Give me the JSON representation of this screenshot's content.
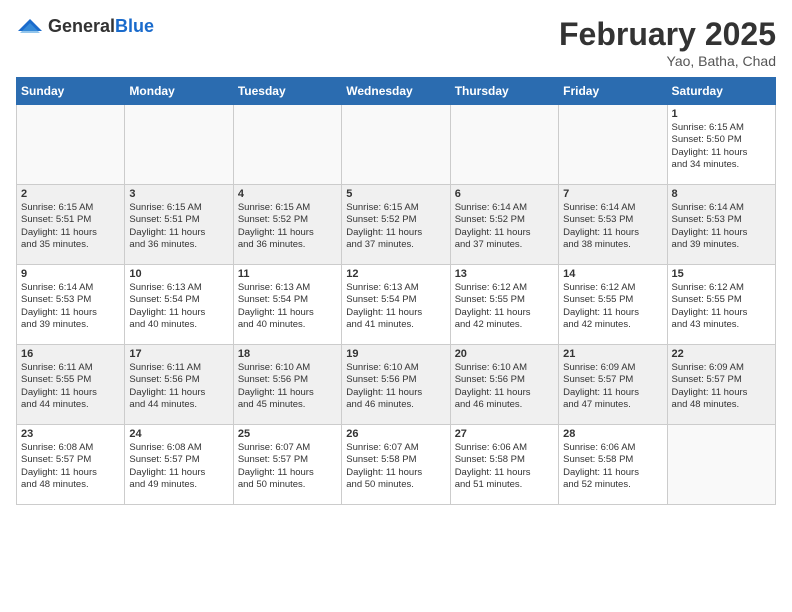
{
  "header": {
    "logo": {
      "general": "General",
      "blue": "Blue"
    },
    "title": "February 2025",
    "location": "Yao, Batha, Chad"
  },
  "calendar": {
    "days_of_week": [
      "Sunday",
      "Monday",
      "Tuesday",
      "Wednesday",
      "Thursday",
      "Friday",
      "Saturday"
    ],
    "weeks": [
      {
        "shaded": false,
        "days": [
          {
            "number": "",
            "info": ""
          },
          {
            "number": "",
            "info": ""
          },
          {
            "number": "",
            "info": ""
          },
          {
            "number": "",
            "info": ""
          },
          {
            "number": "",
            "info": ""
          },
          {
            "number": "",
            "info": ""
          },
          {
            "number": "1",
            "info": "Sunrise: 6:15 AM\nSunset: 5:50 PM\nDaylight: 11 hours\nand 34 minutes."
          }
        ]
      },
      {
        "shaded": true,
        "days": [
          {
            "number": "2",
            "info": "Sunrise: 6:15 AM\nSunset: 5:51 PM\nDaylight: 11 hours\nand 35 minutes."
          },
          {
            "number": "3",
            "info": "Sunrise: 6:15 AM\nSunset: 5:51 PM\nDaylight: 11 hours\nand 36 minutes."
          },
          {
            "number": "4",
            "info": "Sunrise: 6:15 AM\nSunset: 5:52 PM\nDaylight: 11 hours\nand 36 minutes."
          },
          {
            "number": "5",
            "info": "Sunrise: 6:15 AM\nSunset: 5:52 PM\nDaylight: 11 hours\nand 37 minutes."
          },
          {
            "number": "6",
            "info": "Sunrise: 6:14 AM\nSunset: 5:52 PM\nDaylight: 11 hours\nand 37 minutes."
          },
          {
            "number": "7",
            "info": "Sunrise: 6:14 AM\nSunset: 5:53 PM\nDaylight: 11 hours\nand 38 minutes."
          },
          {
            "number": "8",
            "info": "Sunrise: 6:14 AM\nSunset: 5:53 PM\nDaylight: 11 hours\nand 39 minutes."
          }
        ]
      },
      {
        "shaded": false,
        "days": [
          {
            "number": "9",
            "info": "Sunrise: 6:14 AM\nSunset: 5:53 PM\nDaylight: 11 hours\nand 39 minutes."
          },
          {
            "number": "10",
            "info": "Sunrise: 6:13 AM\nSunset: 5:54 PM\nDaylight: 11 hours\nand 40 minutes."
          },
          {
            "number": "11",
            "info": "Sunrise: 6:13 AM\nSunset: 5:54 PM\nDaylight: 11 hours\nand 40 minutes."
          },
          {
            "number": "12",
            "info": "Sunrise: 6:13 AM\nSunset: 5:54 PM\nDaylight: 11 hours\nand 41 minutes."
          },
          {
            "number": "13",
            "info": "Sunrise: 6:12 AM\nSunset: 5:55 PM\nDaylight: 11 hours\nand 42 minutes."
          },
          {
            "number": "14",
            "info": "Sunrise: 6:12 AM\nSunset: 5:55 PM\nDaylight: 11 hours\nand 42 minutes."
          },
          {
            "number": "15",
            "info": "Sunrise: 6:12 AM\nSunset: 5:55 PM\nDaylight: 11 hours\nand 43 minutes."
          }
        ]
      },
      {
        "shaded": true,
        "days": [
          {
            "number": "16",
            "info": "Sunrise: 6:11 AM\nSunset: 5:55 PM\nDaylight: 11 hours\nand 44 minutes."
          },
          {
            "number": "17",
            "info": "Sunrise: 6:11 AM\nSunset: 5:56 PM\nDaylight: 11 hours\nand 44 minutes."
          },
          {
            "number": "18",
            "info": "Sunrise: 6:10 AM\nSunset: 5:56 PM\nDaylight: 11 hours\nand 45 minutes."
          },
          {
            "number": "19",
            "info": "Sunrise: 6:10 AM\nSunset: 5:56 PM\nDaylight: 11 hours\nand 46 minutes."
          },
          {
            "number": "20",
            "info": "Sunrise: 6:10 AM\nSunset: 5:56 PM\nDaylight: 11 hours\nand 46 minutes."
          },
          {
            "number": "21",
            "info": "Sunrise: 6:09 AM\nSunset: 5:57 PM\nDaylight: 11 hours\nand 47 minutes."
          },
          {
            "number": "22",
            "info": "Sunrise: 6:09 AM\nSunset: 5:57 PM\nDaylight: 11 hours\nand 48 minutes."
          }
        ]
      },
      {
        "shaded": false,
        "days": [
          {
            "number": "23",
            "info": "Sunrise: 6:08 AM\nSunset: 5:57 PM\nDaylight: 11 hours\nand 48 minutes."
          },
          {
            "number": "24",
            "info": "Sunrise: 6:08 AM\nSunset: 5:57 PM\nDaylight: 11 hours\nand 49 minutes."
          },
          {
            "number": "25",
            "info": "Sunrise: 6:07 AM\nSunset: 5:57 PM\nDaylight: 11 hours\nand 50 minutes."
          },
          {
            "number": "26",
            "info": "Sunrise: 6:07 AM\nSunset: 5:58 PM\nDaylight: 11 hours\nand 50 minutes."
          },
          {
            "number": "27",
            "info": "Sunrise: 6:06 AM\nSunset: 5:58 PM\nDaylight: 11 hours\nand 51 minutes."
          },
          {
            "number": "28",
            "info": "Sunrise: 6:06 AM\nSunset: 5:58 PM\nDaylight: 11 hours\nand 52 minutes."
          },
          {
            "number": "",
            "info": ""
          }
        ]
      }
    ]
  }
}
